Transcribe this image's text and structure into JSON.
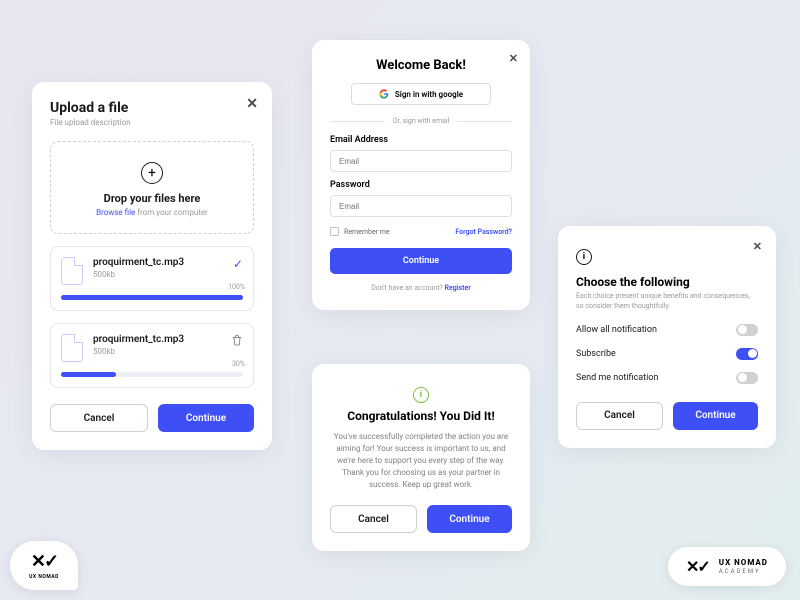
{
  "upload": {
    "title": "Upload a file",
    "subtitle": "File upload description",
    "dropzone": {
      "heading": "Drop your files here",
      "browse_label": "Browse file",
      "browse_suffix": " from your computer"
    },
    "files": [
      {
        "name": "proquirment_tc.mp3",
        "size": "500kb",
        "progress_pct": "100%",
        "progress_val": 100
      },
      {
        "name": "proquirment_tc.mp3",
        "size": "500kb",
        "progress_pct": "30%",
        "progress_val": 30
      }
    ],
    "cancel": "Cancel",
    "continue": "Continue"
  },
  "login": {
    "title": "Welcome Back!",
    "google_btn": "Sign in with google",
    "divider": "Or, sign with email",
    "email_label": "Email Address",
    "email_placeholder": "Email",
    "password_label": "Password",
    "password_placeholder": "Email",
    "remember": "Remember me",
    "forgot": "Forgot Password?",
    "continue": "Continue",
    "no_account": "Don't have an account?  ",
    "register": "Register"
  },
  "congrats": {
    "title": "Congratulations! You Did It!",
    "body": "You've successfully completed the action you are aiming for! Your success is important to us, and we're here to support you every step of the way. Thank you for choosing us as your partner in success. Keep up great work.",
    "cancel": "Cancel",
    "continue": "Continue"
  },
  "choice": {
    "title": "Choose the following",
    "subtitle": "Each choice present unique benefits and consequences, so consider them thoughtfully.",
    "options": [
      {
        "label": "Allow all notification",
        "on": false
      },
      {
        "label": "Subscribe",
        "on": true
      },
      {
        "label": "Send me notification",
        "on": false
      }
    ],
    "cancel": "Cancel",
    "continue": "Continue"
  },
  "brand": {
    "name": "UX NOMAD",
    "academy_l1": "UX NOMAD",
    "academy_l2": "ACADEMY"
  }
}
